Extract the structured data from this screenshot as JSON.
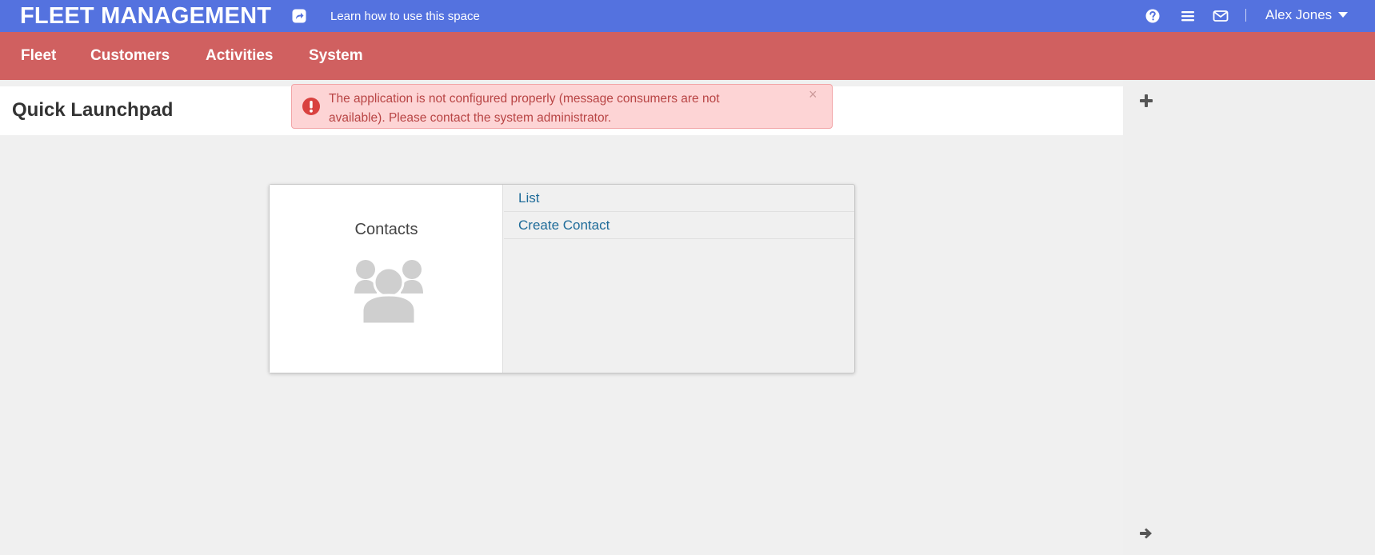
{
  "app": {
    "title": "FLEET MANAGEMENT",
    "learn_link": "Learn how to use this space",
    "user_name": "Alex Jones"
  },
  "nav": {
    "items": [
      "Fleet",
      "Customers",
      "Activities",
      "System"
    ]
  },
  "page": {
    "title": "Quick Launchpad"
  },
  "alert": {
    "message": "The application is not configured properly (message consumers are not available). Please contact the system administrator.",
    "close_label": "×"
  },
  "launchpad": {
    "card_title": "Contacts",
    "links": [
      "List",
      "Create Contact"
    ]
  },
  "colors": {
    "topbar": "#5472df",
    "navbar": "#d06060",
    "alert_bg": "#fdd4d5",
    "link": "#1e6b99"
  },
  "icons": {
    "share": "share-icon",
    "help": "help-icon",
    "menu": "menu-icon",
    "mail": "mail-icon",
    "user_caret": "chevron-down-icon",
    "alert": "exclamation-icon",
    "contacts": "users-icon",
    "sidebar_add": "plus-icon",
    "sidebar_expand": "arrow-right-icon"
  }
}
